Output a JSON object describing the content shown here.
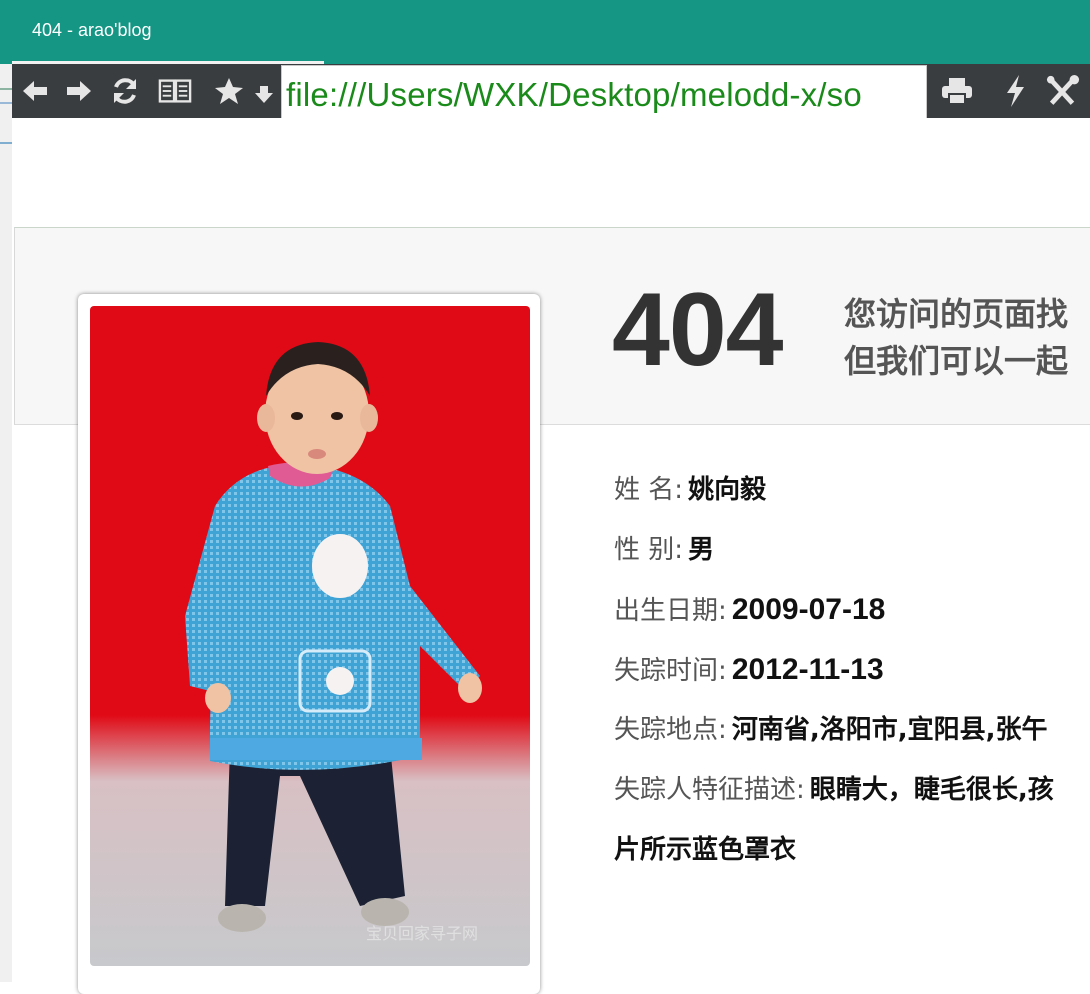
{
  "tab": {
    "title": "404 - arao'blog"
  },
  "toolbar": {
    "buttons": [
      "back-icon",
      "forward-icon",
      "reload-icon",
      "reader-icon",
      "bookmark-star-icon",
      "print-icon",
      "lightning-icon",
      "tools-icon"
    ],
    "url": "file:///Users/WXK/Desktop/melodd-x/so"
  },
  "error": {
    "code": "404",
    "line1": "您访问的页面找",
    "line2": "但我们可以一起"
  },
  "photo": {
    "watermark": "宝贝回家寻子网"
  },
  "person": {
    "name_label": "姓 名:",
    "name_value": "姚向毅",
    "gender_label": "性 别:",
    "gender_value": "男",
    "birth_label": "出生日期:",
    "birth_value": "2009-07-18",
    "missing_time_label": "失踪时间:",
    "missing_time_value": "2012-11-13",
    "missing_place_label": "失踪地点:",
    "missing_place_value": "河南省,洛阳市,宜阳县,张午",
    "features_label": "失踪人特征描述:",
    "features_value": "眼睛大，睫毛很长,孩",
    "features_value_cont": "片所示蓝色罩衣"
  },
  "colors": {
    "tabbar": "#159684",
    "toolbar": "#3a3d3f",
    "url_text": "#1a8a1a",
    "photo_background": "#e00a16"
  }
}
